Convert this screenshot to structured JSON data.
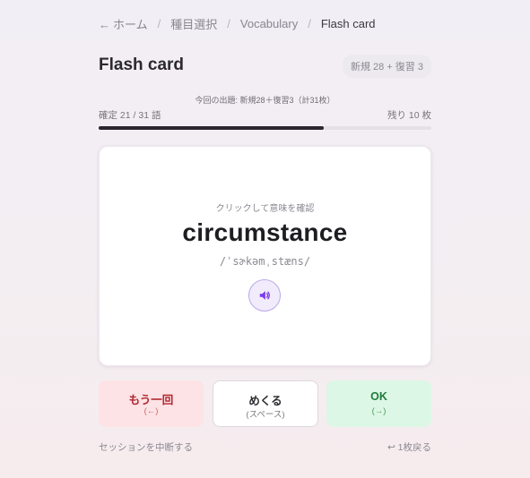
{
  "breadcrumb": {
    "home_arrow": "←",
    "home": "ホーム",
    "category": "種目選択",
    "deck": "Vocabulary",
    "current": "Flash card",
    "separator": "/"
  },
  "header": {
    "title": "Flash card",
    "badge": "新規 28 + 復習 3"
  },
  "progress": {
    "plan_text": "今回の出題: 新規28＋復習3（計31枚）",
    "done_text": "確定 21 / 31 語",
    "remaining_text": "残り 10 枚",
    "confirmed": 21,
    "total": 31,
    "fraction": 0.677
  },
  "card": {
    "hint": "クリックして意味を確認",
    "word": "circumstance",
    "ipa": "/ˈsɚkəmˌstæns/",
    "audio_icon": "speaker-icon"
  },
  "actions": {
    "again_label": "もう一回",
    "again_key": "(←)",
    "flip_label": "めくる",
    "flip_key": "(スペース)",
    "ok_label": "OK",
    "ok_key": "(→)"
  },
  "footer": {
    "quit_label": "セッションを中断する",
    "back_label": "↩ 1枚戻る"
  },
  "colors": {
    "again_bg": "#fde3e5",
    "again_text": "#b0242e",
    "ok_bg": "#dcf7e5",
    "ok_text": "#1f7a3a",
    "progress_fill": "#2a2630",
    "audio_accent": "#7c3aed"
  }
}
